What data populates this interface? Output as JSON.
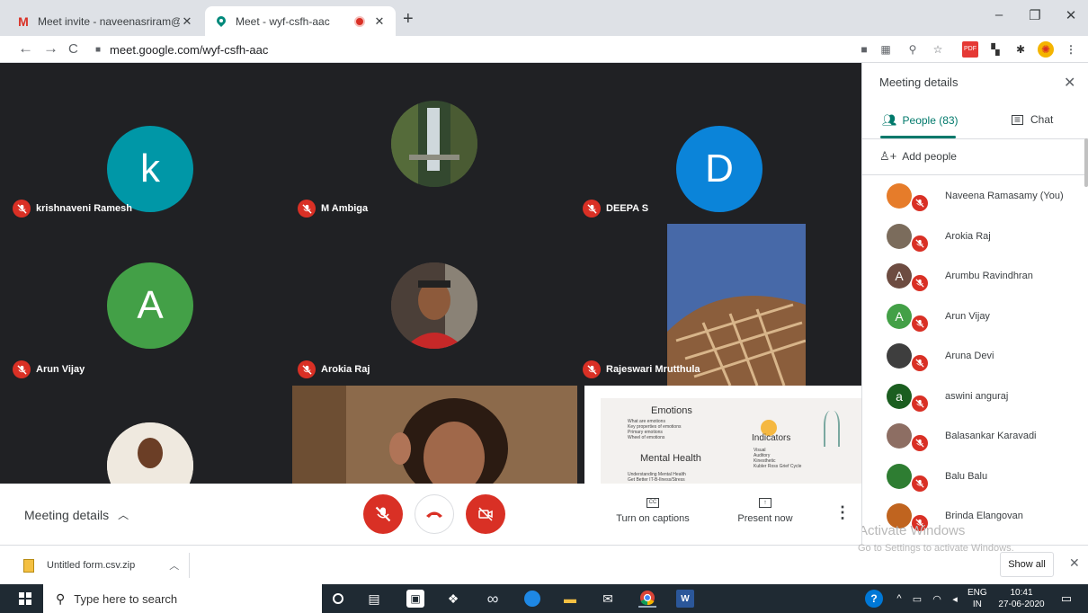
{
  "browser": {
    "tabs": [
      {
        "title": "Meet invite - naveenasriram@gm",
        "favicon": "gmail-icon",
        "color": "#d93025"
      },
      {
        "title": "Meet - wyf-csfh-aac",
        "favicon": "meet-icon",
        "color": "#00897b"
      }
    ],
    "url": "meet.google.com/wyf-csfh-aac"
  },
  "tiles": [
    {
      "name": "krishnaveni Ramesh",
      "initial": "k",
      "color": "#0097a7"
    },
    {
      "name": "M Ambiga"
    },
    {
      "name": "DEEPA S",
      "initial": "D",
      "color": "#0b84d9"
    },
    {
      "name": "Arun Vijay",
      "initial": "A",
      "color": "#43a047"
    },
    {
      "name": "Arokia Raj"
    },
    {
      "name": "Rajeswari Mrutthula"
    }
  ],
  "slide": {
    "title1": "Emotions",
    "lines1": [
      "What are emotions",
      "Key properties of emotions",
      "Primary emotions",
      "Wheel of emotions"
    ],
    "title2": "Mental Health",
    "lines2": [
      "Understanding Mental Health",
      "Get Better IT-B-Ilness/Stress"
    ],
    "title3": "Indicators",
    "lines3": [
      "Visual",
      "Auditory",
      "Kinesthetic",
      "Kubler Ross Grief Cycle"
    ]
  },
  "controls": {
    "meeting_details": "Meeting details",
    "captions": "Turn on captions",
    "present": "Present now"
  },
  "panel": {
    "title": "Meeting details",
    "people_tab": "People (83)",
    "chat_tab": "Chat",
    "add_people": "Add people",
    "people": [
      {
        "name": "Naveena Ramasamy (You)",
        "initial": "",
        "color": "#e67c2a"
      },
      {
        "name": "Arokia Raj",
        "initial": "",
        "color": "#7b6c5c"
      },
      {
        "name": "Arumbu Ravindhran",
        "initial": "A",
        "color": "#6d4c41"
      },
      {
        "name": "Arun Vijay",
        "initial": "A",
        "color": "#43a047"
      },
      {
        "name": "Aruna Devi",
        "initial": "",
        "color": "#3e3e3e"
      },
      {
        "name": "aswini anguraj",
        "initial": "a",
        "color": "#1b5e20"
      },
      {
        "name": "Balasankar Karavadi",
        "initial": "",
        "color": "#8d6e63"
      },
      {
        "name": "Balu Balu",
        "initial": "",
        "color": "#2e7d32"
      },
      {
        "name": "Brinda Elangovan",
        "initial": "",
        "color": "#c0641f"
      }
    ]
  },
  "watermark": {
    "line1": "Activate Windows",
    "line2": "Go to Settings to activate Windows."
  },
  "download": {
    "file": "Untitled form.csv.zip",
    "show_all": "Show all"
  },
  "taskbar": {
    "search_placeholder": "Type here to search",
    "lang": "ENG",
    "region": "IN",
    "time": "10:41",
    "date": "27-06-2020"
  }
}
